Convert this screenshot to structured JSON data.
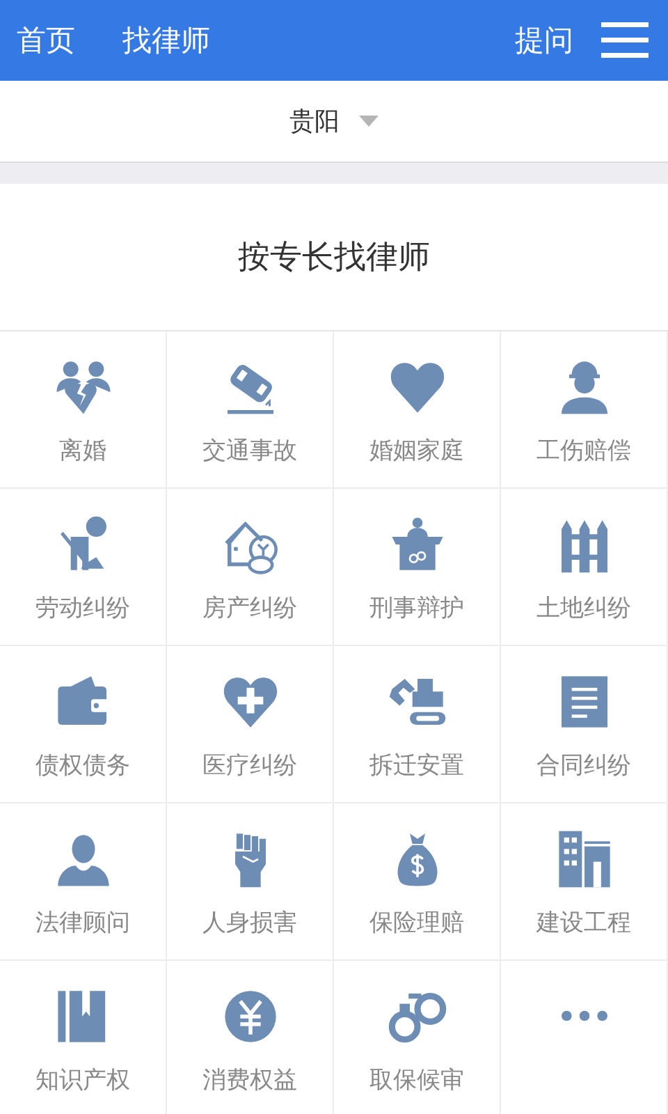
{
  "header": {
    "nav": [
      {
        "label": "首页"
      },
      {
        "label": "找律师"
      }
    ],
    "ask": "提问"
  },
  "city": {
    "value": "贵阳"
  },
  "section_title": "按专长找律师",
  "categories": [
    {
      "kind": "divorce",
      "label": "离婚"
    },
    {
      "kind": "traffic",
      "label": "交通事故"
    },
    {
      "kind": "heart",
      "label": "婚姻家庭"
    },
    {
      "kind": "worker",
      "label": "工伤赔偿"
    },
    {
      "kind": "labor",
      "label": "劳动纠纷"
    },
    {
      "kind": "house",
      "label": "房产纠纷"
    },
    {
      "kind": "podium",
      "label": "刑事辩护"
    },
    {
      "kind": "fence",
      "label": "土地纠纷"
    },
    {
      "kind": "wallet",
      "label": "债权债务"
    },
    {
      "kind": "medical",
      "label": "医疗纠纷"
    },
    {
      "kind": "excavator",
      "label": "拆迁安置"
    },
    {
      "kind": "document",
      "label": "合同纠纷"
    },
    {
      "kind": "person",
      "label": "法律顾问"
    },
    {
      "kind": "fist",
      "label": "人身损害"
    },
    {
      "kind": "moneybag",
      "label": "保险理赔"
    },
    {
      "kind": "building",
      "label": "建设工程"
    },
    {
      "kind": "book",
      "label": "知识产权"
    },
    {
      "kind": "yen",
      "label": "消费权益"
    },
    {
      "kind": "handcuffs",
      "label": "取保候审"
    },
    {
      "kind": "more"
    }
  ]
}
